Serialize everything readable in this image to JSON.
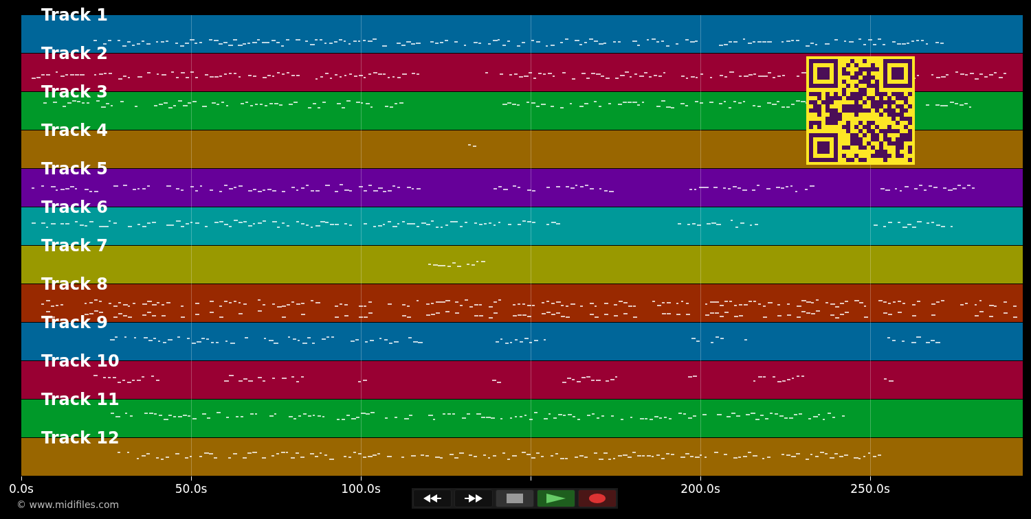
{
  "tracks": [
    {
      "name": "Track 1",
      "color": "#006699"
    },
    {
      "name": "Track 2",
      "color": "#990033"
    },
    {
      "name": "Track 3",
      "color": "#009929"
    },
    {
      "name": "Track 4",
      "color": "#996600"
    },
    {
      "name": "Track 5",
      "color": "#660099"
    },
    {
      "name": "Track 6",
      "color": "#009999"
    },
    {
      "name": "Track 7",
      "color": "#999900"
    },
    {
      "name": "Track 8",
      "color": "#992900"
    },
    {
      "name": "Track 9",
      "color": "#006699"
    },
    {
      "name": "Track 10",
      "color": "#990033"
    },
    {
      "name": "Track 11",
      "color": "#009929"
    },
    {
      "name": "Track 12",
      "color": "#996600"
    }
  ],
  "time_axis": {
    "ticks": [
      "0.0s",
      "50.0s",
      "100.0s",
      "200.0s",
      "250.0s"
    ]
  },
  "controls": [
    {
      "kind": "rewind"
    },
    {
      "kind": "forward"
    },
    {
      "kind": "stop"
    },
    {
      "kind": "play"
    },
    {
      "kind": "record"
    }
  ],
  "copyright": "© www.midifiles.com"
}
